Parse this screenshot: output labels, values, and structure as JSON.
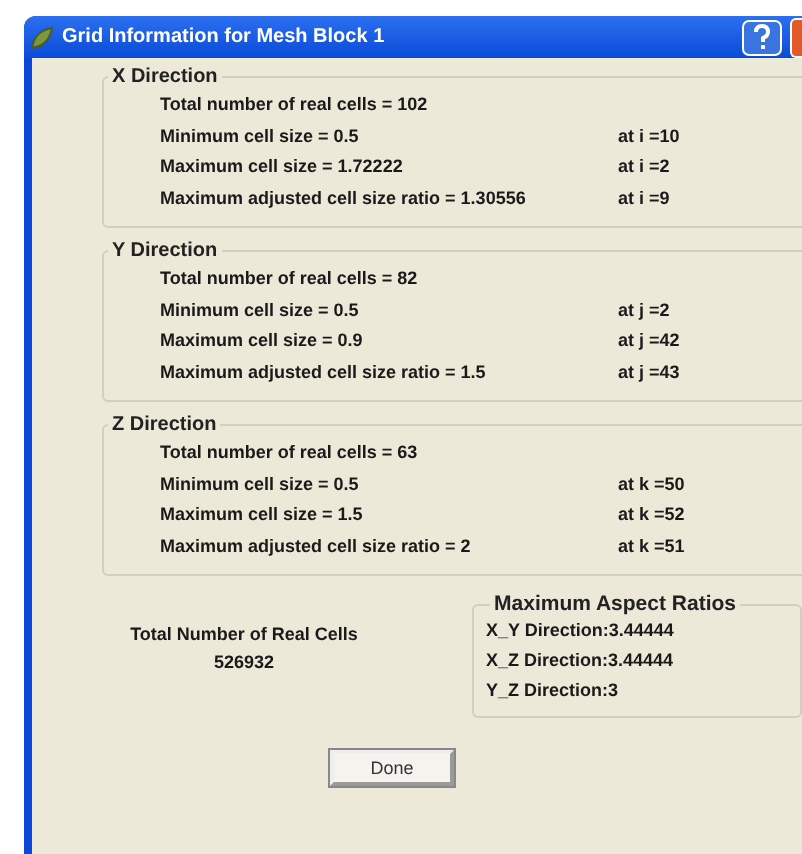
{
  "window": {
    "title": "Grid Information for Mesh Block 1"
  },
  "groups": [
    {
      "title": "X Direction",
      "total": "Total number of real cells = 102",
      "rows": [
        {
          "label": "Minimum cell size = 0.5",
          "at": "at i =10"
        },
        {
          "label": "Maximum cell size = 1.72222",
          "at": "at i =2"
        },
        {
          "label": "Maximum adjusted cell size ratio = 1.30556",
          "at": "at i =9"
        }
      ]
    },
    {
      "title": "Y Direction",
      "total": "Total number of real cells = 82",
      "rows": [
        {
          "label": "Minimum cell size = 0.5",
          "at": "at j =2"
        },
        {
          "label": "Maximum cell size = 0.9",
          "at": "at j =42"
        },
        {
          "label": "Maximum adjusted cell size ratio = 1.5",
          "at": "at j =43"
        }
      ]
    },
    {
      "title": "Z Direction",
      "total": "Total number of real cells = 63",
      "rows": [
        {
          "label": "Minimum cell size = 0.5",
          "at": "at k =50"
        },
        {
          "label": "Maximum cell size = 1.5",
          "at": "at k =52"
        },
        {
          "label": "Maximum adjusted cell size ratio = 2",
          "at": "at k =51"
        }
      ]
    }
  ],
  "total_cells": {
    "label": "Total Number of Real Cells",
    "value": "526932"
  },
  "aspect_ratios": {
    "title": "Maximum Aspect Ratios",
    "items": [
      "X_Y Direction:3.44444",
      "X_Z Direction:3.44444",
      "Y_Z Direction:3"
    ]
  },
  "buttons": [
    "Done"
  ]
}
